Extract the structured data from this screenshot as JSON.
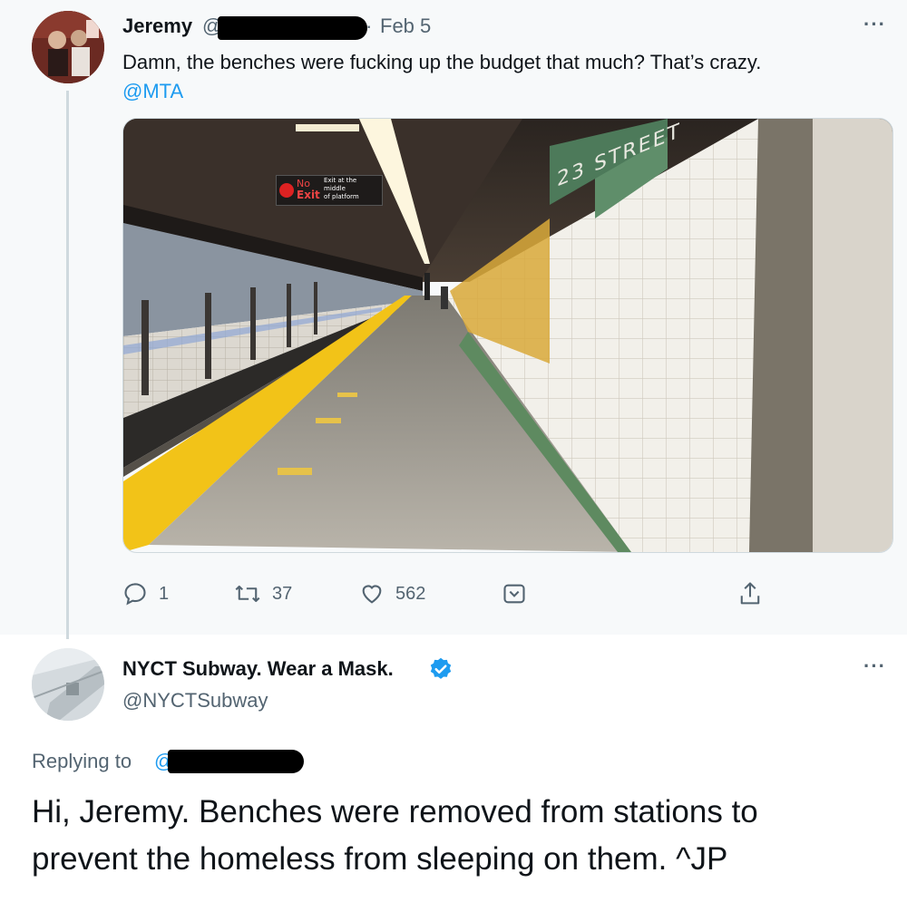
{
  "tweet1": {
    "name": "Jeremy",
    "handle_prefix": "@",
    "separator": "·",
    "date": "Feb 5",
    "more": "···",
    "text": "Damn, the benches were fucking up the budget that much? That’s crazy.",
    "mention": "@MTA",
    "photo_sign": {
      "no_exit_top": "No",
      "no_exit_bottom": "Exit",
      "exit_line1": "Exit at the",
      "exit_line2": "middle",
      "exit_line3": "of platform",
      "station_tiles": "23 STREET"
    },
    "actions": {
      "reply_count": "1",
      "retweet_count": "37",
      "like_count": "562"
    }
  },
  "tweet2": {
    "name": "NYCT Subway. Wear a Mask.",
    "handle": "@NYCTSubway",
    "more": "···",
    "replying_to": "Replying to",
    "replying_handle_prefix": "@",
    "line1": "Hi, Jeremy. Benches were removed from stations to",
    "line2": "prevent the homeless from sleeping on them. ^JP"
  },
  "colors": {
    "link": "#1d9bf0",
    "secondary": "#536471",
    "verified": "#1d9bf0",
    "platform_edge": "#f2c318"
  }
}
